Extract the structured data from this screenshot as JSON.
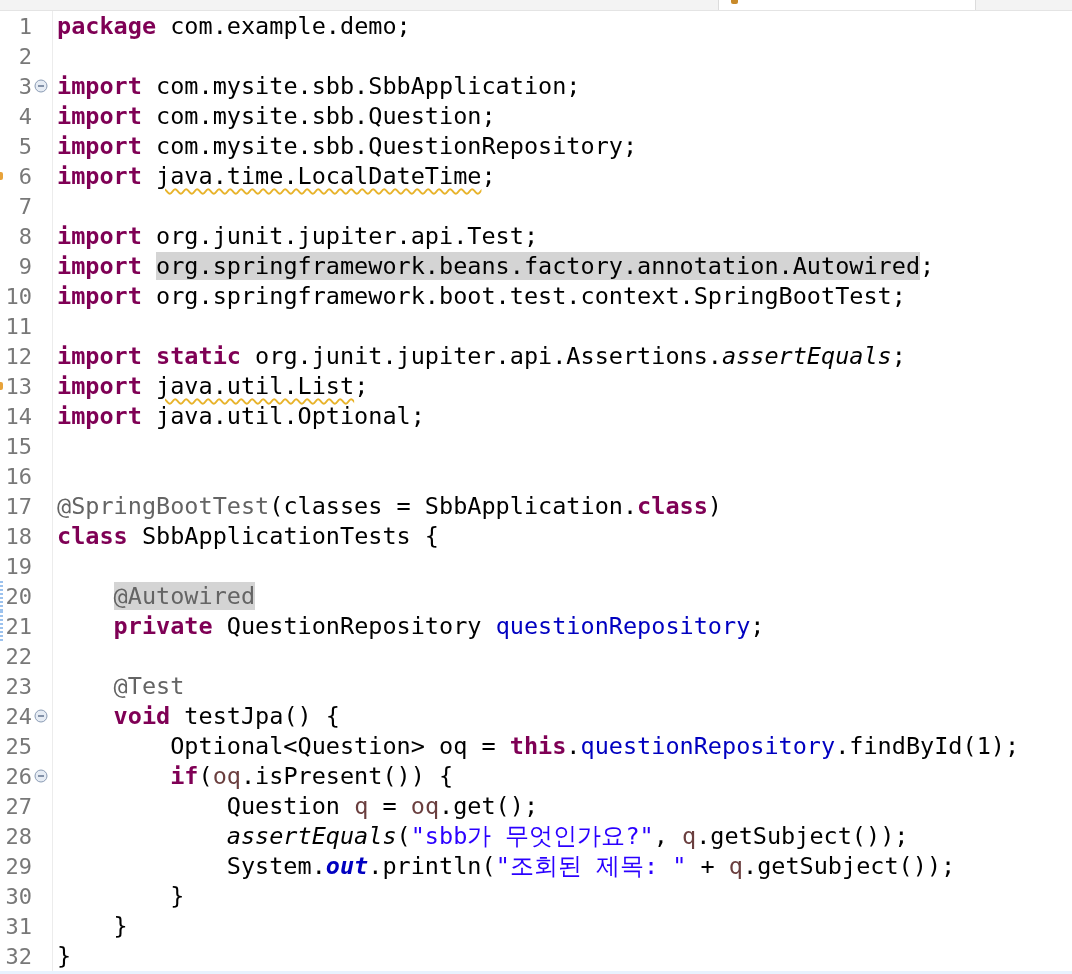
{
  "lines": [
    {
      "number": "1",
      "kind": "plain",
      "tokens": [
        {
          "kind": "keyword",
          "text": "package"
        },
        {
          "kind": "plain",
          "text": " com.example.demo;"
        }
      ]
    },
    {
      "number": "2",
      "kind": "plain"
    },
    {
      "number": "3",
      "kind": "plain",
      "expanded": true,
      "tokens": [
        {
          "kind": "keyword",
          "text": "import"
        },
        {
          "kind": "plain",
          "text": " com.mysite.sbb.SbbApplication;"
        }
      ]
    },
    {
      "number": "4",
      "kind": "plain",
      "tokens": [
        {
          "kind": "keyword",
          "text": "import"
        },
        {
          "kind": "plain",
          "text": " com.mysite.sbb.Question;"
        }
      ]
    },
    {
      "number": "5",
      "kind": "plain",
      "tokens": [
        {
          "kind": "keyword",
          "text": "import"
        },
        {
          "kind": "plain",
          "text": " com.mysite.sbb.QuestionRepository;"
        }
      ]
    },
    {
      "number": "6",
      "kind": "warning",
      "tokens": [
        {
          "kind": "keyword",
          "text": "import "
        },
        {
          "kind": "warning",
          "text": "java.time.LocalDateTime"
        },
        {
          "kind": "plain",
          "text": ";"
        }
      ]
    },
    {
      "number": "7",
      "kind": "plain"
    },
    {
      "number": "8",
      "kind": "plain",
      "tokens": [
        {
          "kind": "keyword",
          "text": "import"
        },
        {
          "kind": "plain",
          "text": " org.junit.jupiter.api.Test;"
        }
      ]
    },
    {
      "number": "9",
      "kind": "plain",
      "tokens": [
        {
          "kind": "keyword",
          "text": "import "
        },
        {
          "kind": "occurrence",
          "text": "org.springframework.beans.factory.annotation.Autowired"
        },
        {
          "kind": "plain",
          "text": ";"
        }
      ]
    },
    {
      "number": "10",
      "kind": "plain",
      "tokens": [
        {
          "kind": "keyword",
          "text": "import"
        },
        {
          "kind": "plain",
          "text": " org.springframework.boot.test.context.SpringBootTest;"
        }
      ]
    },
    {
      "number": "11",
      "kind": "plain"
    },
    {
      "number": "12",
      "kind": "plain",
      "tokens": [
        {
          "kind": "keyword",
          "text": "import static"
        },
        {
          "kind": "plain",
          "text": " org.junit.jupiter.api.Assertions."
        },
        {
          "kind": "static-call",
          "text": "assertEquals"
        },
        {
          "kind": "plain",
          "text": ";"
        }
      ]
    },
    {
      "number": "13",
      "kind": "warning",
      "tokens": [
        {
          "kind": "keyword",
          "text": "import "
        },
        {
          "kind": "warning",
          "text": "java.util.List"
        },
        {
          "kind": "plain",
          "text": ";"
        }
      ]
    },
    {
      "number": "14",
      "kind": "plain",
      "tokens": [
        {
          "kind": "keyword",
          "text": "import"
        },
        {
          "kind": "plain",
          "text": " java.util.Optional;"
        }
      ]
    },
    {
      "number": "15",
      "kind": "plain"
    },
    {
      "number": "16",
      "kind": "plain"
    },
    {
      "number": "17",
      "kind": "plain",
      "tokens": [
        {
          "kind": "annotation",
          "text": "@SpringBootTest"
        },
        {
          "kind": "plain",
          "text": "(classes = SbbApplication."
        },
        {
          "kind": "keyword",
          "text": "class"
        },
        {
          "kind": "plain",
          "text": ")"
        }
      ]
    },
    {
      "number": "18",
      "kind": "plain",
      "tokens": [
        {
          "kind": "keyword",
          "text": "class"
        },
        {
          "kind": "plain",
          "text": " SbbApplicationTests {"
        }
      ]
    },
    {
      "number": "19",
      "kind": "plain"
    },
    {
      "number": "20",
      "kind": "change",
      "tokens": [
        {
          "kind": "annotation-occurrence",
          "text": "    @Autowired"
        }
      ]
    },
    {
      "number": "21",
      "kind": "change",
      "tokens": [
        {
          "kind": "keyword",
          "text": "    private"
        },
        {
          "kind": "plain",
          "text": " QuestionRepository "
        },
        {
          "kind": "field",
          "text": "questionRepository"
        },
        {
          "kind": "plain",
          "text": ";"
        }
      ]
    },
    {
      "number": "22",
      "kind": "plain"
    },
    {
      "number": "23",
      "kind": "plain",
      "tokens": [
        {
          "kind": "annotation",
          "text": "    @Test"
        }
      ]
    },
    {
      "number": "24",
      "kind": "plain",
      "expanded": true,
      "tokens": [
        {
          "kind": "keyword",
          "text": "    void"
        },
        {
          "kind": "plain",
          "text": " testJpa() {"
        }
      ]
    },
    {
      "number": "25",
      "kind": "plain",
      "tokens": [
        {
          "kind": "plain",
          "text": "        Optional<Question> oq = "
        },
        {
          "kind": "keyword",
          "text": "this"
        },
        {
          "kind": "plain",
          "text": "."
        },
        {
          "kind": "field",
          "text": "questionRepository"
        },
        {
          "kind": "plain",
          "text": ".findById(1);"
        }
      ]
    },
    {
      "number": "26",
      "kind": "plain",
      "expanded": true,
      "tokens": [
        {
          "kind": "keyword",
          "text": "        if"
        },
        {
          "kind": "plain",
          "text": "("
        },
        {
          "kind": "local",
          "text": "oq"
        },
        {
          "kind": "plain",
          "text": ".isPresent()) {"
        }
      ]
    },
    {
      "number": "27",
      "kind": "plain",
      "tokens": [
        {
          "kind": "plain",
          "text": "            Question "
        },
        {
          "kind": "local",
          "text": "q"
        },
        {
          "kind": "plain",
          "text": " = "
        },
        {
          "kind": "local",
          "text": "oq"
        },
        {
          "kind": "plain",
          "text": ".get();"
        }
      ]
    },
    {
      "number": "28",
      "kind": "plain",
      "tokens": [
        {
          "kind": "static-call",
          "text": "            assertEquals"
        },
        {
          "kind": "plain",
          "text": "("
        },
        {
          "kind": "string",
          "text": "\"sbb가 무엇인가요?\""
        },
        {
          "kind": "plain",
          "text": ", "
        },
        {
          "kind": "local",
          "text": "q"
        },
        {
          "kind": "plain",
          "text": ".getSubject());"
        }
      ]
    },
    {
      "number": "29",
      "kind": "plain",
      "tokens": [
        {
          "kind": "plain",
          "text": "            System."
        },
        {
          "kind": "static-field",
          "text": "out"
        },
        {
          "kind": "plain",
          "text": ".println("
        },
        {
          "kind": "string",
          "text": "\"조회된 제목: \""
        },
        {
          "kind": "plain",
          "text": " + "
        },
        {
          "kind": "local",
          "text": "q"
        },
        {
          "kind": "plain",
          "text": ".getSubject());"
        }
      ]
    },
    {
      "number": "30",
      "kind": "plain",
      "tokens": [
        {
          "kind": "plain",
          "text": "        }"
        }
      ]
    },
    {
      "number": "31",
      "kind": "plain",
      "tokens": [
        {
          "kind": "plain",
          "text": "    }"
        }
      ]
    },
    {
      "number": "32",
      "kind": "plain",
      "tokens": [
        {
          "kind": "plain",
          "text": "}"
        }
      ]
    }
  ]
}
